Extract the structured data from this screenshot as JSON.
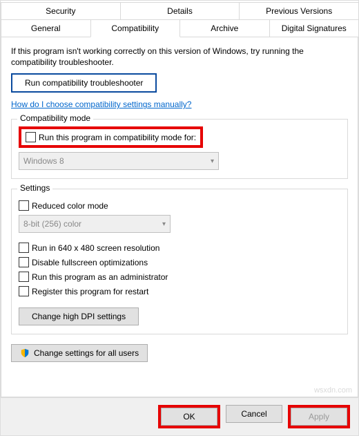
{
  "tabs": {
    "row1": [
      "Security",
      "Details",
      "Previous Versions"
    ],
    "row2": [
      "General",
      "Compatibility",
      "Archive",
      "Digital Signatures"
    ],
    "active": "Compatibility"
  },
  "intro": "If this program isn't working correctly on this version of Windows, try running the compatibility troubleshooter.",
  "btn_troubleshooter": "Run compatibility troubleshooter",
  "link_manual": "How do I choose compatibility settings manually?",
  "group_compat": {
    "title": "Compatibility mode",
    "check_label": "Run this program in compatibility mode for:",
    "select_value": "Windows 8"
  },
  "group_settings": {
    "title": "Settings",
    "reduced_color": "Reduced color mode",
    "color_select": "8-bit (256) color",
    "run_640": "Run in 640 x 480 screen resolution",
    "disable_fs": "Disable fullscreen optimizations",
    "run_admin": "Run this program as an administrator",
    "register_restart": "Register this program for restart",
    "btn_dpi": "Change high DPI settings"
  },
  "btn_allusers": "Change settings for all users",
  "footer": {
    "ok": "OK",
    "cancel": "Cancel",
    "apply": "Apply"
  },
  "watermark": "wsxdn.com"
}
